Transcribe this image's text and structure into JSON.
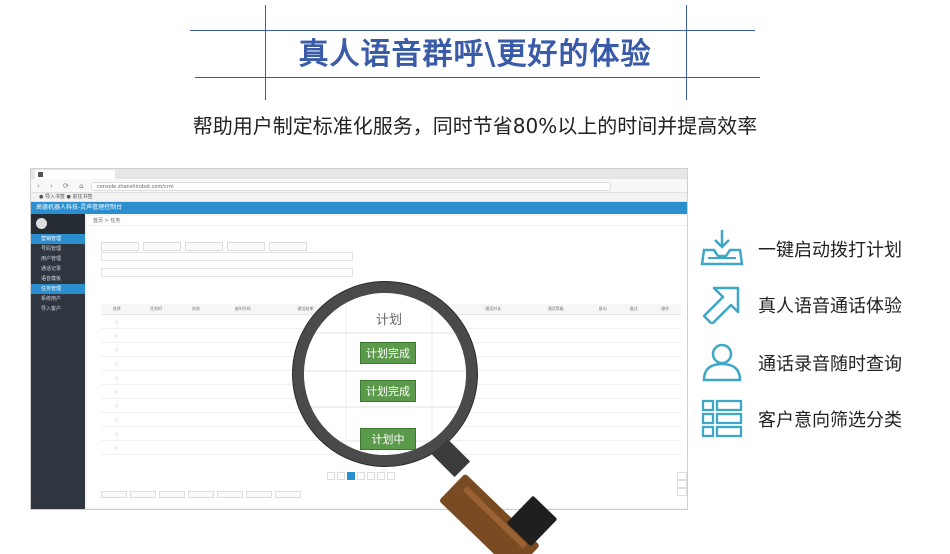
{
  "header": {
    "title": "真人语音群呼\\更好的体验",
    "subtitle": "帮助用户制定标准化服务，同时节省80%以上的时间并提高效率"
  },
  "screenshot": {
    "app_title": "高德机器人科技-灵声管理控制台",
    "url": "console.zhanshirobot.com/crm",
    "bookmarks": "● 导入书签   ● 前往书签",
    "breadcrumb": "首页 > 任务",
    "sidebar_items": [
      "营销管理",
      "号码管理",
      "用户管理",
      "通话记录",
      "语音模板",
      "任务管理",
      "系统用户",
      "导入客户"
    ],
    "table_headers": [
      "选择",
      "任务ID",
      "状态",
      "被叫号码",
      "通话结果",
      "",
      "",
      "",
      "开始时间",
      "结束时间",
      "通话时长",
      "通话等级",
      "意向",
      "备注",
      "操作"
    ],
    "row_count": 10
  },
  "magnifier": {
    "column_header": "计划",
    "statuses": [
      "计划完成",
      "计划完成",
      "计划中"
    ]
  },
  "features": [
    {
      "icon": "download-tray-icon",
      "label": "一键启动拨打计划"
    },
    {
      "icon": "arrow-up-right-icon",
      "label": "真人语音通话体验"
    },
    {
      "icon": "user-icon",
      "label": "通话录音随时查询"
    },
    {
      "icon": "list-category-icon",
      "label": "客户意向筛选分类"
    }
  ],
  "colors": {
    "accent": "#3a5ba8",
    "app_blue": "#2b8fcf",
    "icon_teal": "#3fa7c6",
    "status_green": "#5a9a4a"
  }
}
